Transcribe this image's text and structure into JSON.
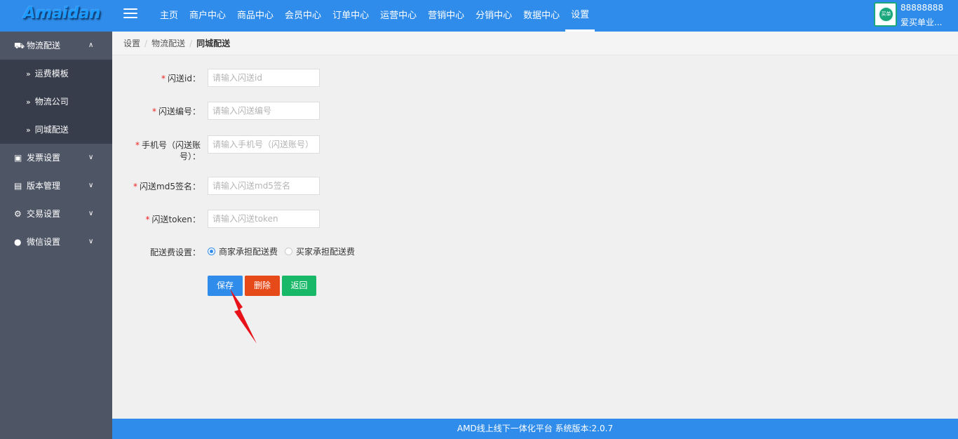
{
  "header": {
    "logo": "Amaidan",
    "nav": [
      {
        "label": "主页"
      },
      {
        "label": "商户中心"
      },
      {
        "label": "商品中心"
      },
      {
        "label": "会员中心"
      },
      {
        "label": "订单中心"
      },
      {
        "label": "运营中心"
      },
      {
        "label": "营销中心"
      },
      {
        "label": "分销中心"
      },
      {
        "label": "数据中心"
      },
      {
        "label": "设置",
        "active": true
      }
    ],
    "user": {
      "id": "88888888",
      "name": "爱买单业...",
      "avatar_text": "买单"
    }
  },
  "sidebar": {
    "groups": [
      {
        "label": "物流配送",
        "icon": "truck-icon",
        "expanded": true,
        "items": [
          {
            "label": "运费模板"
          },
          {
            "label": "物流公司"
          },
          {
            "label": "同城配送",
            "active": true
          }
        ]
      },
      {
        "label": "发票设置",
        "icon": "invoice-icon",
        "expanded": false
      },
      {
        "label": "版本管理",
        "icon": "version-icon",
        "expanded": false
      },
      {
        "label": "交易设置",
        "icon": "gears-icon",
        "expanded": false
      },
      {
        "label": "微信设置",
        "icon": "wechat-icon",
        "expanded": false
      }
    ]
  },
  "breadcrumb": {
    "items": [
      "设置",
      "物流配送",
      "同城配送"
    ],
    "separator": "/"
  },
  "form": {
    "fields": [
      {
        "label": "闪送id：",
        "required": true,
        "value": "",
        "placeholder": "请输入闪送id"
      },
      {
        "label": "闪送编号：",
        "required": true,
        "value": "",
        "placeholder": "请输入闪送编号"
      },
      {
        "label": "手机号（闪送账号）：",
        "required": true,
        "value": "",
        "placeholder": "请输入手机号（闪送账号）"
      },
      {
        "label": "闪送md5签名：",
        "required": true,
        "value": "",
        "placeholder": "请输入闪送md5签名"
      },
      {
        "label": "闪送token：",
        "required": true,
        "value": "",
        "placeholder": "请输入闪送token"
      }
    ],
    "delivery_fee": {
      "label": "配送费设置：",
      "options": [
        {
          "label": "商家承担配送费",
          "checked": true
        },
        {
          "label": "买家承担配送费",
          "checked": false
        }
      ]
    },
    "buttons": {
      "save": "保存",
      "delete": "删除",
      "back": "返回"
    },
    "required_mark": "*"
  },
  "footer": {
    "text": "AMD线上线下一体化平台 系统版本:2.0.7"
  },
  "colors": {
    "primary": "#2f8cea",
    "sidebar": "#4e5565",
    "sidebar_sub": "#373d4b",
    "danger": "#e64a19",
    "success": "#19b868",
    "required": "#e22222",
    "annotation_arrow": "#e8121a"
  }
}
